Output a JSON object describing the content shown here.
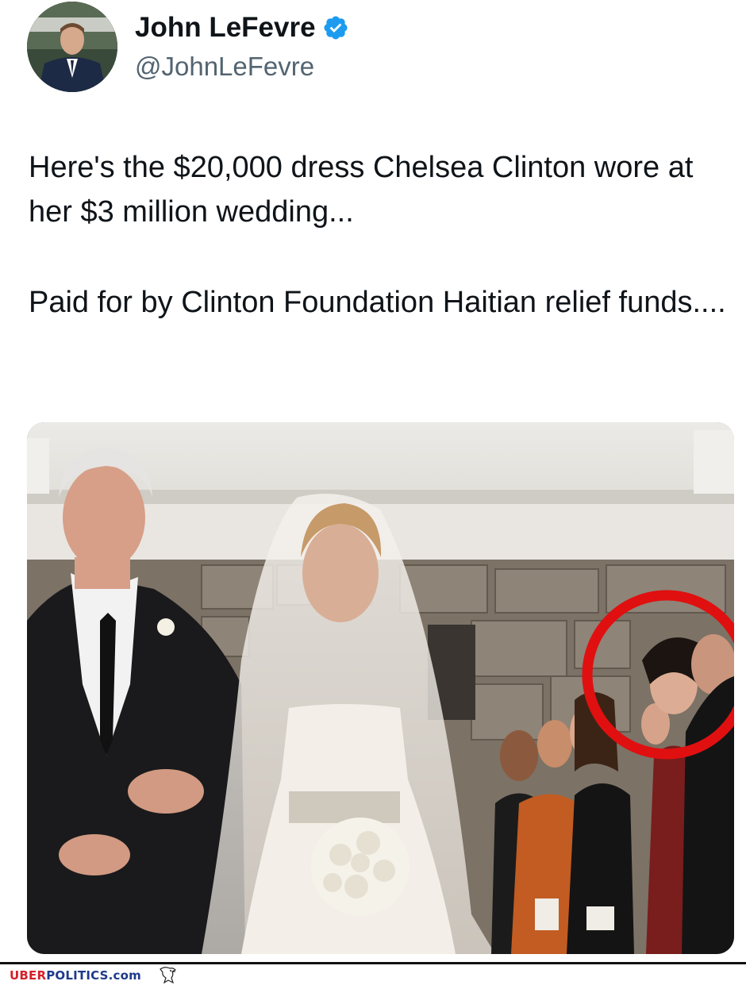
{
  "tweet": {
    "author": {
      "display_name": "John LeFevre",
      "handle": "@JohnLeFevre",
      "verified": true,
      "avatar_icon": "profile-photo"
    },
    "text_paragraphs": [
      "Here's the $20,000 dress Chelsea Clinton wore at her $3 million wedding...",
      "Paid for by Clinton Foundation Haitian relief funds...."
    ],
    "media": {
      "type": "photo",
      "highlight_color": "#e01010"
    }
  },
  "footer": {
    "brand_primary": "UBER",
    "brand_secondary": "POLITICS.com",
    "brand_icon": "eagle-icon",
    "primary_color": "#d4202a",
    "secondary_color": "#1f3a8a"
  },
  "colors": {
    "verified_badge": "#1d9bf0",
    "text": "#0f1419",
    "secondary_text": "#536471"
  }
}
